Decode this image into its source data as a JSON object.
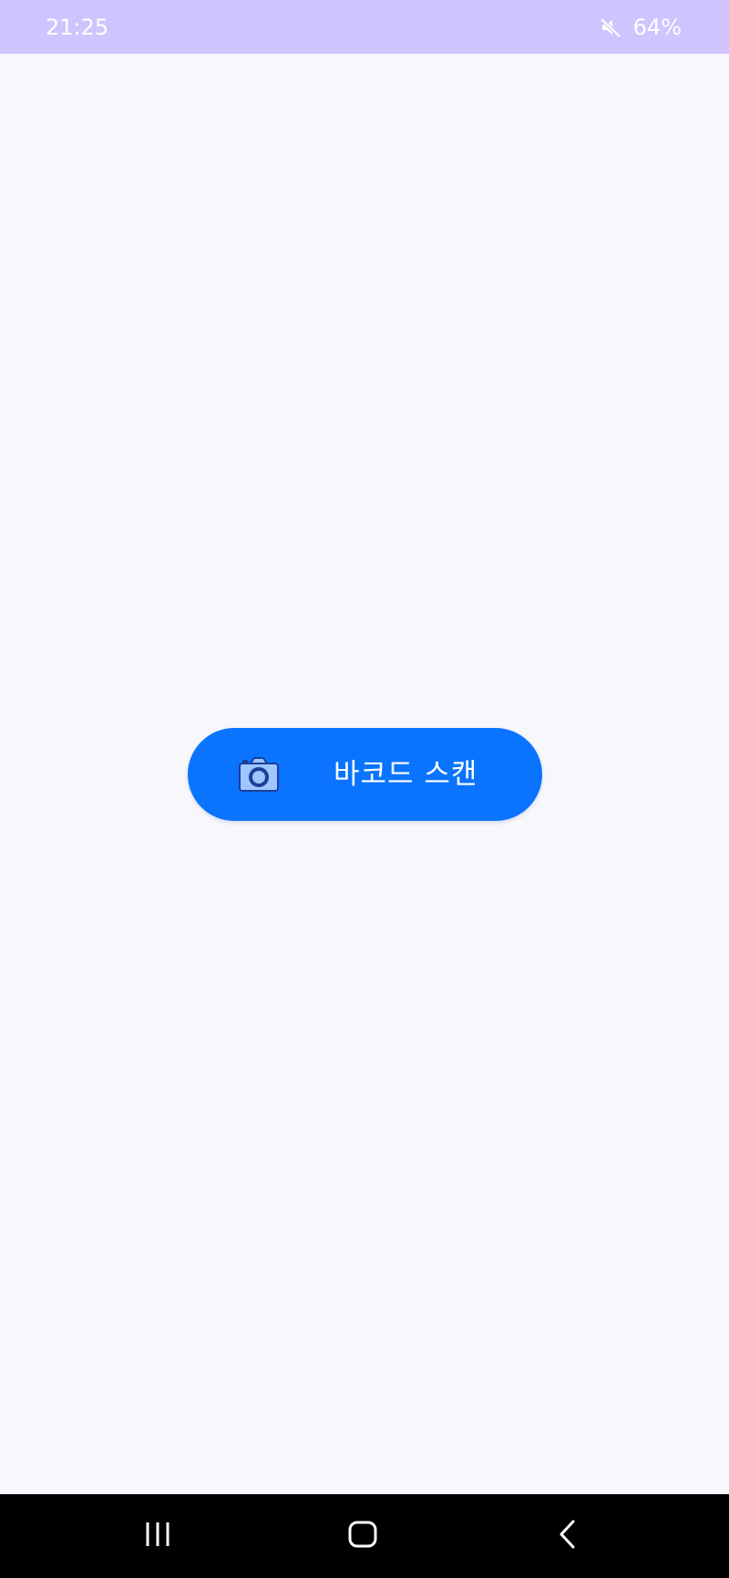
{
  "status_bar": {
    "time": "21:25",
    "battery": "64%",
    "icons": [
      "mute-icon"
    ]
  },
  "main": {
    "scan_button": {
      "label": "바코드 스캔",
      "icon": "camera-icon"
    }
  },
  "navigation_bar": {
    "buttons": [
      "recents-icon",
      "home-icon",
      "back-icon"
    ]
  },
  "colors": {
    "status_bar": "#d0c4ff",
    "background": "#f7f7fc",
    "button": "#0a74ff",
    "nav_bar": "#000000"
  }
}
